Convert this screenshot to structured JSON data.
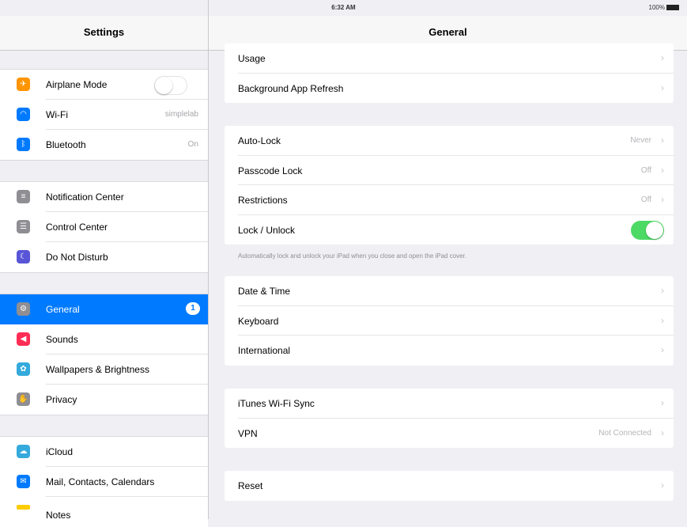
{
  "status": {
    "device": "iPad",
    "time": "6:32 AM",
    "battery": "100%"
  },
  "sidebar": {
    "title": "Settings",
    "groups": [
      [
        {
          "label": "Airplane Mode",
          "icon": "airplane-icon",
          "color": "#ff9500",
          "value": ""
        },
        {
          "label": "Wi-Fi",
          "icon": "wifi-icon",
          "color": "#007aff",
          "value": "simplelab"
        },
        {
          "label": "Bluetooth",
          "icon": "bluetooth-icon",
          "color": "#007aff",
          "value": "On"
        }
      ],
      [
        {
          "label": "Notification Center",
          "icon": "notification-center-icon",
          "color": "#8e8e93"
        },
        {
          "label": "Control Center",
          "icon": "control-center-icon",
          "color": "#8e8e93"
        },
        {
          "label": "Do Not Disturb",
          "icon": "moon-icon",
          "color": "#5856d6"
        }
      ],
      [
        {
          "label": "General",
          "icon": "gear-icon",
          "color": "#8e8e93",
          "badge": "1"
        },
        {
          "label": "Sounds",
          "icon": "speaker-icon",
          "color": "#ff2d55"
        },
        {
          "label": "Wallpapers & Brightness",
          "icon": "wallpaper-icon",
          "color": "#34aadc"
        },
        {
          "label": "Privacy",
          "icon": "hand-icon",
          "color": "#8e8e93"
        }
      ],
      [
        {
          "label": "iCloud",
          "icon": "cloud-icon",
          "color": "#34aadc"
        },
        {
          "label": "Mail, Contacts, Calendars",
          "icon": "mail-icon",
          "color": "#007aff"
        },
        {
          "label": "Notes",
          "icon": "notes-icon",
          "color": "#ffcc00"
        }
      ]
    ]
  },
  "main": {
    "title": "General",
    "groups": [
      [
        {
          "label": "Usage"
        },
        {
          "label": "Background App Refresh"
        }
      ],
      [
        {
          "label": "Auto-Lock",
          "value": "Never"
        },
        {
          "label": "Passcode Lock",
          "value": "Off"
        },
        {
          "label": "Restrictions",
          "value": "Off"
        },
        {
          "label": "Lock / Unlock",
          "toggle": true
        }
      ],
      [
        {
          "label": "Date & Time"
        },
        {
          "label": "Keyboard"
        },
        {
          "label": "International"
        }
      ],
      [
        {
          "label": "iTunes Wi-Fi Sync"
        },
        {
          "label": "VPN",
          "value": "Not Connected"
        }
      ],
      [
        {
          "label": "Reset"
        }
      ]
    ],
    "lock_footnote": "Automatically lock and unlock your iPad when you close and open the iPad cover."
  }
}
